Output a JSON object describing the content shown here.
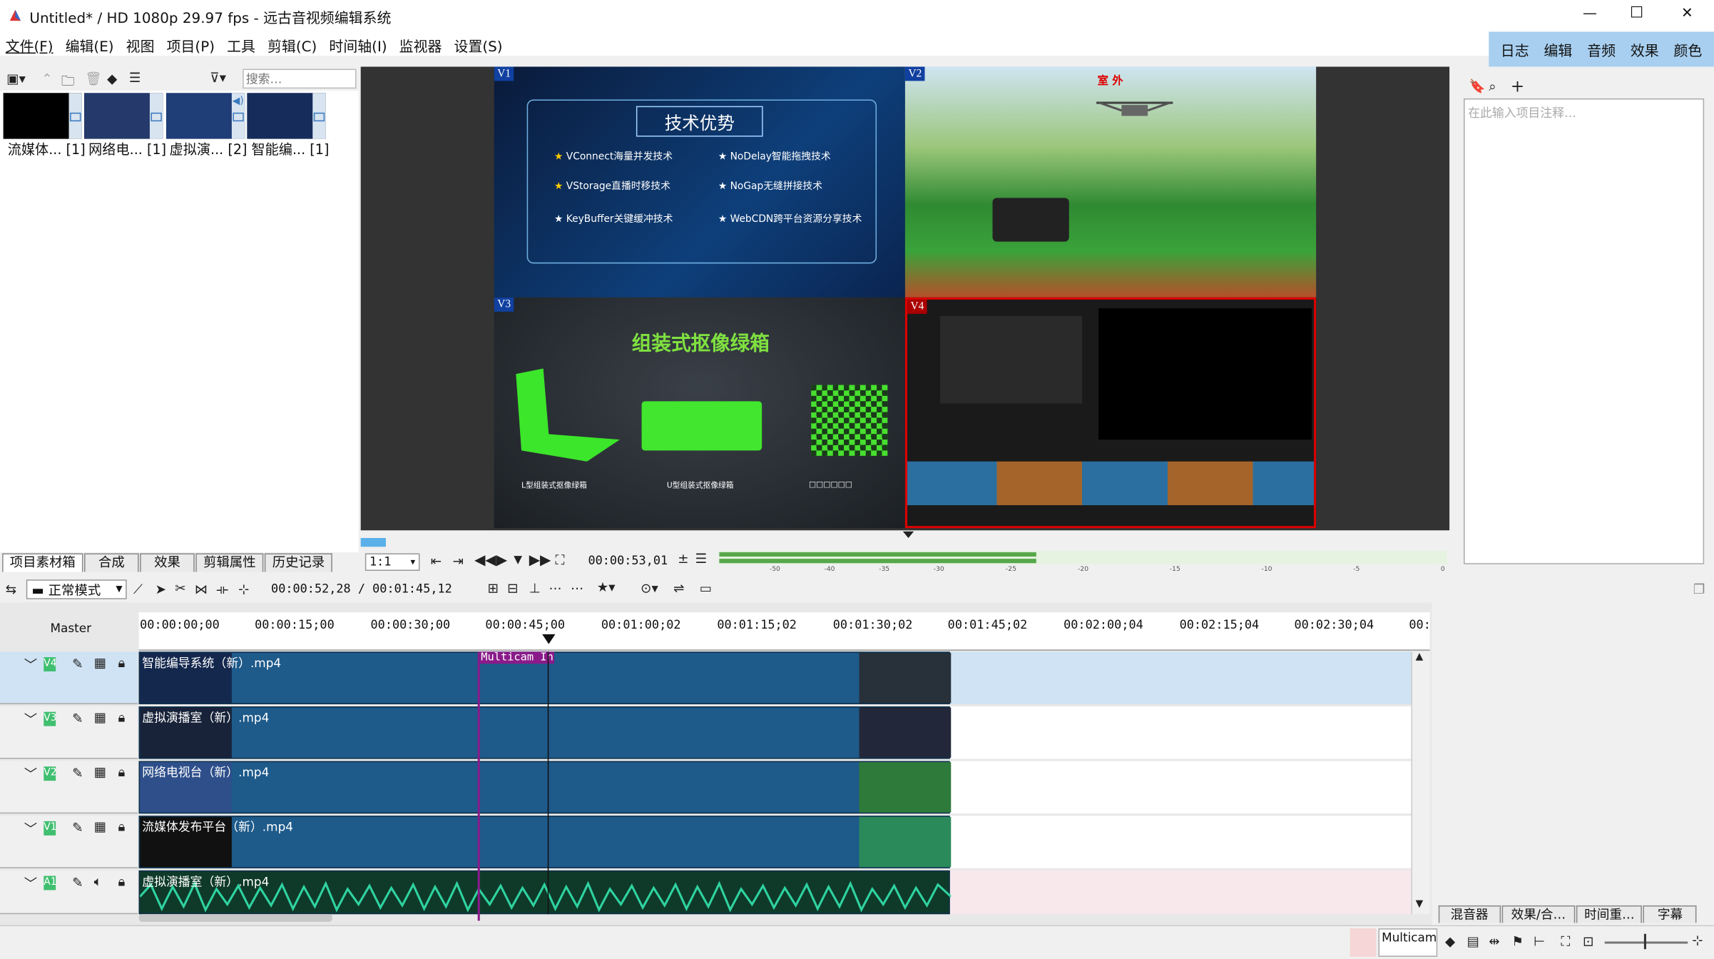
{
  "window": {
    "title": "Untitled* / HD 1080p 29.97 fps - 远古音视频编辑系统",
    "controls": {
      "minimize": "—",
      "maximize": "☐",
      "close": "✕"
    }
  },
  "menu": [
    "文件(F)",
    "编辑(E)",
    "视图",
    "项目(P)",
    "工具",
    "剪辑(C)",
    "时间轴(I)",
    "监视器",
    "设置(S)"
  ],
  "top_tabs": [
    "日志",
    "编辑",
    "音频",
    "效果",
    "颜色"
  ],
  "bin": {
    "search_placeholder": "搜索…",
    "items": [
      {
        "label": "流媒体... [1]"
      },
      {
        "label": "网络电... [1]"
      },
      {
        "label": "虚拟演... [2]"
      },
      {
        "label": "智能编... [1]"
      }
    ],
    "tabs": [
      "项目素材箱",
      "合成",
      "效果",
      "剪辑属性",
      "历史记录"
    ]
  },
  "notes": {
    "placeholder": "在此输入项目注释…"
  },
  "viewer": {
    "quads": [
      {
        "label": "V1",
        "heading": "技术优势",
        "items": [
          "VConnect海量并发技术",
          "NoDelay智能拖拽技术",
          "VStorage直播时移技术",
          "NoGap无缝拼接技术",
          "KeyBuffer关键缓冲技术",
          "WebCDN跨平台资源分享技术"
        ]
      },
      {
        "label": "V2",
        "heading": "室 外"
      },
      {
        "label": "V3",
        "heading": "组装式抠像绿箱",
        "captions": [
          "L型组装式抠像绿箱",
          "U型组装式抠像绿箱",
          "□□□□□□"
        ]
      },
      {
        "label": "V4"
      }
    ],
    "zoom": "1:1",
    "timecode": "00:00:53,01",
    "meter_ticks": [
      "-50",
      "-40",
      "-35",
      "-30",
      "-25",
      "-20",
      "-15",
      "-10",
      "-5",
      "0"
    ]
  },
  "timeline": {
    "mode": "正常模式",
    "position": "00:00:52,28 / 00:01:45,12",
    "master": "Master",
    "ruler": [
      "00:00:00;00",
      "00:00:15;00",
      "00:00:30;00",
      "00:00:45;00",
      "00:01:00;02",
      "00:01:15;02",
      "00:01:30;02",
      "00:01:45;02",
      "00:02:00;04",
      "00:02:15;04",
      "00:02:30;04",
      "00:"
    ],
    "tracks": [
      {
        "label": "V4",
        "clip": "智能编导系统（新）.mp4"
      },
      {
        "label": "V3",
        "clip": "虚拟演播室（新）.mp4"
      },
      {
        "label": "V2",
        "clip": "网络电视台（新）.mp4"
      },
      {
        "label": "V1",
        "clip": "流媒体发布平台（新）.mp4"
      },
      {
        "label": "A1",
        "clip": "虚拟演播室（新）.mp4"
      }
    ],
    "marker": "Multicam In"
  },
  "bottom_tabs": [
    "混音器",
    "效果/合…",
    "时间重…",
    "字幕"
  ],
  "status": {
    "multicam": "Multicam"
  },
  "colors": {
    "accent_tab": "#a8cff0",
    "clip": "#1e5a8a",
    "audio": "#0f6b4a",
    "marker": "#8a1a8a",
    "selected_track": "#cfe3f4"
  }
}
